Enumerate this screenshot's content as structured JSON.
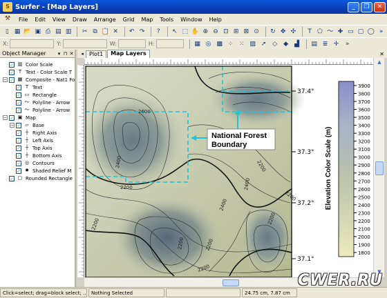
{
  "app": {
    "title": "Surfer - [Map Layers]",
    "window_buttons": [
      "_",
      "❐",
      "✕"
    ]
  },
  "menu": [
    "File",
    "Edit",
    "View",
    "Draw",
    "Arrange",
    "Grid",
    "Map",
    "Tools",
    "Window",
    "Help"
  ],
  "coords": {
    "x_label": "X:",
    "y_label": "Y:",
    "w_label": "W:",
    "h_label": "H:"
  },
  "object_manager": {
    "title": "Object Manager",
    "items": [
      {
        "label": "Color Scale",
        "icon": "color-scale-icon",
        "level": 0
      },
      {
        "label": "Text - Color Scale T",
        "icon": "text-icon",
        "level": 0
      },
      {
        "label": "Composite - Nat1 Fo",
        "icon": "composite-icon",
        "level": 0
      },
      {
        "label": "Text",
        "icon": "text-icon",
        "level": 1
      },
      {
        "label": "Rectangle",
        "icon": "rectangle-icon",
        "level": 1
      },
      {
        "label": "Polyline - Arrow",
        "icon": "polyline-icon",
        "level": 1
      },
      {
        "label": "Polyline - Arrow",
        "icon": "polyline-icon",
        "level": 1
      },
      {
        "label": "Map",
        "icon": "map-icon",
        "level": 0
      },
      {
        "label": "Base",
        "icon": "base-icon",
        "level": 1
      },
      {
        "label": "Right Axis",
        "icon": "axis-icon",
        "level": 1
      },
      {
        "label": "Left Axis",
        "icon": "axis-icon",
        "level": 1
      },
      {
        "label": "Top Axis",
        "icon": "axis-icon",
        "level": 1
      },
      {
        "label": "Bottom Axis",
        "icon": "axis-icon",
        "level": 1
      },
      {
        "label": "Contours",
        "icon": "contours-icon",
        "level": 1
      },
      {
        "label": "Shaded Relief M",
        "icon": "shaded-relief-icon",
        "level": 1
      },
      {
        "label": "Rounded Rectangle",
        "icon": "rounded-rectangle-icon",
        "level": 0
      }
    ]
  },
  "tabs": [
    "Plot1",
    "Map Layers"
  ],
  "map": {
    "annotation": "National Forest\nBoundary",
    "annotation_line1": "National Forest",
    "annotation_line2": "Boundary",
    "lat_labels": [
      "37.4°",
      "37.3°",
      "37.2°",
      "37.1°"
    ],
    "contour_labels": [
      "2600",
      "2400",
      "2200",
      "2200",
      "2200",
      "2200",
      "2400",
      "2200",
      "2200",
      "2200",
      "2200",
      "2400"
    ],
    "colorbar_title": "Elevation Color Scale (m)",
    "colorbar_values": [
      "3900",
      "3800",
      "3700",
      "3600",
      "3500",
      "3400",
      "3300",
      "3200",
      "3100",
      "3000",
      "2900",
      "2800",
      "2700",
      "2600",
      "2500",
      "2400",
      "2300",
      "2200",
      "2100",
      "2000",
      "1900",
      "1800"
    ]
  },
  "status": {
    "hint": "Click=select; drag=block select; ...",
    "selection": "Nothing Selected",
    "position": "24.75 cm, 7.87 cm"
  },
  "watermark": "CWER.RU",
  "colors": {
    "title_bar": "#0a4fc8",
    "forest_boundary": "#19c8d8",
    "map_low": "#e4ddae",
    "map_high": "#3a4a58"
  }
}
